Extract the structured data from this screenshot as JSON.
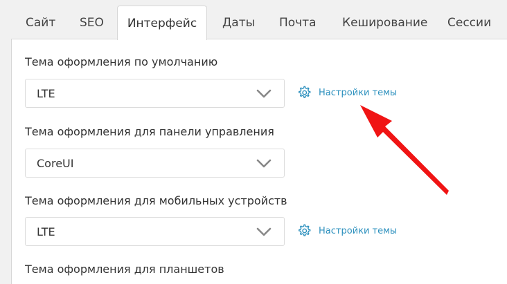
{
  "tabs": [
    {
      "label": "Сайт"
    },
    {
      "label": "SEO"
    },
    {
      "label": "Интерфейс",
      "active": true
    },
    {
      "label": "Даты"
    },
    {
      "label": "Почта"
    },
    {
      "label": "Кеширование"
    },
    {
      "label": "Сессии"
    }
  ],
  "settings": {
    "default_theme": {
      "label": "Тема оформления по умолчанию",
      "value": "LTE",
      "link": "Настройки темы"
    },
    "admin_theme": {
      "label": "Тема оформления для панели управления",
      "value": "CoreUI"
    },
    "mobile_theme": {
      "label": "Тема оформления для мобильных устройств",
      "value": "LTE",
      "link": "Настройки темы"
    },
    "tablet_theme": {
      "label": "Тема оформления для планшетов"
    }
  },
  "colors": {
    "link": "#2a8fbd",
    "annotation_arrow": "#f01414"
  },
  "icons": {
    "select_arrow": "chevron-down-icon",
    "settings": "gear-icon"
  }
}
